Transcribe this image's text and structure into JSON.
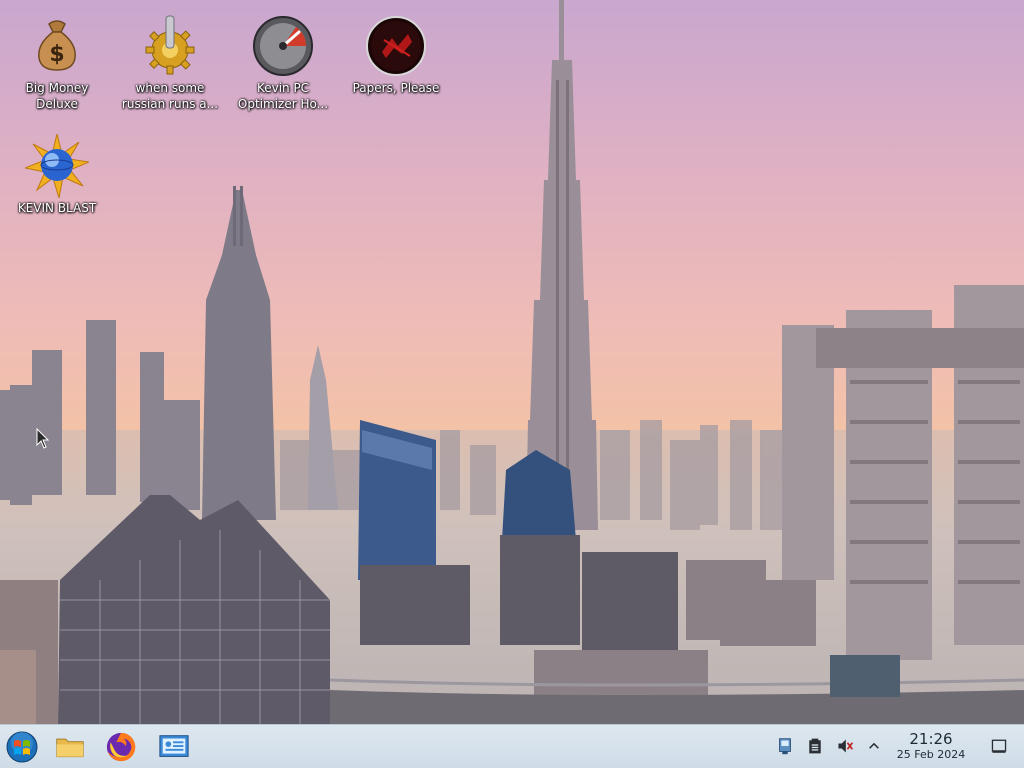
{
  "desktop": {
    "icons": [
      {
        "label_line1": "Big Money",
        "label_line2": "Deluxe",
        "icon": "money-bag-icon"
      },
      {
        "label_line1": "when some",
        "label_line2": "russian runs a...",
        "icon": "gear-icon"
      },
      {
        "label_line1": "Kevin PC",
        "label_line2": "Optimizer Ho...",
        "icon": "speedometer-icon"
      },
      {
        "label_line1": "Papers, Please",
        "label_line2": "",
        "icon": "papers-please-icon"
      },
      {
        "label_line1": "KEVIN BLAST",
        "label_line2": "",
        "icon": "blast-globe-icon"
      }
    ],
    "wallpaper": "dubai-skyline-wallpaper"
  },
  "taskbar": {
    "pinned": [
      {
        "name": "start-button",
        "icon": "windows-orb-icon"
      },
      {
        "name": "file-explorer-button",
        "icon": "folder-icon"
      },
      {
        "name": "firefox-button",
        "icon": "firefox-icon"
      },
      {
        "name": "control-panel-button",
        "icon": "control-panel-icon"
      }
    ],
    "tray": {
      "icons": [
        "network-icon",
        "clipboard-icon",
        "volume-muted-icon",
        "chevron-up-icon"
      ]
    },
    "clock": {
      "time": "21:26",
      "date": "25 Feb 2024"
    }
  },
  "colors": {
    "taskbar_bg": "#dde7ef",
    "label_text": "#ffffff",
    "clock_text": "#1e2a35"
  }
}
